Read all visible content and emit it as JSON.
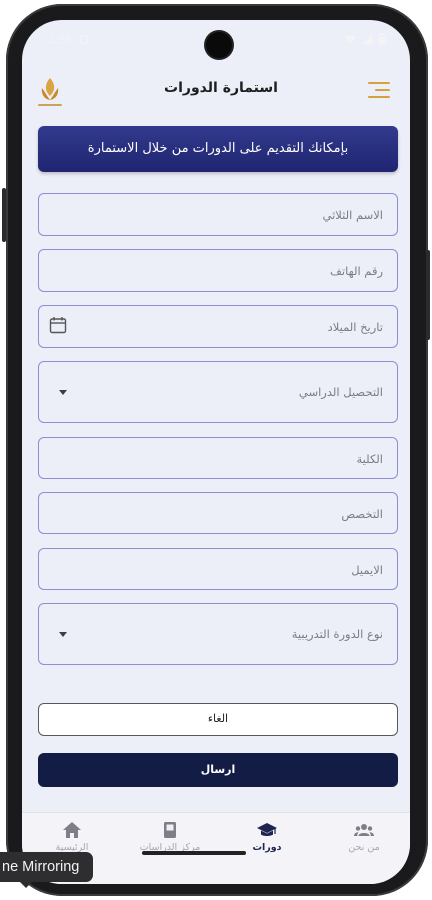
{
  "status_bar": {
    "time": "1:56"
  },
  "app_bar": {
    "title": "استمارة الدورات"
  },
  "banner": {
    "text": "بإمكانك التقديم على الدورات من خلال الاستمارة"
  },
  "form": {
    "full_name_placeholder": "الاسم الثلاثي",
    "phone_placeholder": "رقم الهاتف",
    "birthdate_placeholder": "تاريخ الميلاد",
    "education_placeholder": "التحصيل الدراسي",
    "college_placeholder": "الكلية",
    "specialization_placeholder": "التخصص",
    "email_placeholder": "الايميل",
    "course_type_placeholder": "نوع الدورة التدريبية"
  },
  "buttons": {
    "cancel_label": "الغاء",
    "submit_label": "ارسال"
  },
  "bottom_nav": {
    "items": [
      {
        "label": "الرئيسية",
        "icon": "home-icon"
      },
      {
        "label": "مركز الدراسات",
        "icon": "book-icon"
      },
      {
        "label": "دورات",
        "icon": "graduation-cap-icon",
        "active": true
      },
      {
        "label": "من نحن",
        "icon": "group-icon"
      }
    ]
  },
  "overlay": {
    "tooltip": "ne Mirroring"
  },
  "colors": {
    "banner": "#262d80",
    "submit": "#131c45",
    "field_border": "#8c8fd4",
    "accent_gold": "#d4a23c",
    "screen_bg": "#eceef8"
  }
}
